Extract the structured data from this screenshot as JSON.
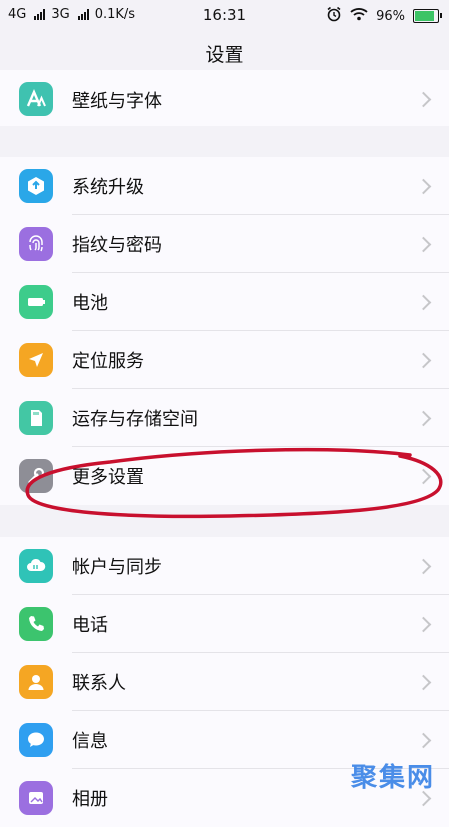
{
  "status_bar": {
    "net1": "4G",
    "net2": "3G",
    "speed": "0.1K/s",
    "time": "16:31",
    "battery": "96%"
  },
  "nav": {
    "title": "设置"
  },
  "groups": [
    {
      "items": [
        {
          "label": "壁纸与字体",
          "icon": "font-a-icon",
          "color": "#3fc2b0"
        }
      ]
    },
    {
      "items": [
        {
          "label": "系统升级",
          "icon": "upgrade-box-icon",
          "color": "#2aa7e8"
        },
        {
          "label": "指纹与密码",
          "icon": "fingerprint-icon",
          "color": "#9b6fe0"
        },
        {
          "label": "电池",
          "icon": "battery-icon",
          "color": "#3dcc8b"
        },
        {
          "label": "定位服务",
          "icon": "location-arrow-icon",
          "color": "#f5a623"
        },
        {
          "label": "运存与存储空间",
          "icon": "sd-card-icon",
          "color": "#43c7a4"
        },
        {
          "label": "更多设置",
          "icon": "wrench-icon",
          "color": "#8e8e96"
        }
      ]
    },
    {
      "items": [
        {
          "label": "帐户与同步",
          "icon": "cloud-sync-icon",
          "color": "#2fc3b7"
        },
        {
          "label": "电话",
          "icon": "phone-icon",
          "color": "#3cc46e"
        },
        {
          "label": "联系人",
          "icon": "contact-icon",
          "color": "#f5a623"
        },
        {
          "label": "信息",
          "icon": "message-icon",
          "color": "#2f9ff0"
        },
        {
          "label": "相册",
          "icon": "album-icon",
          "color": "#9b6fe0"
        }
      ]
    }
  ],
  "watermark": "聚集网"
}
